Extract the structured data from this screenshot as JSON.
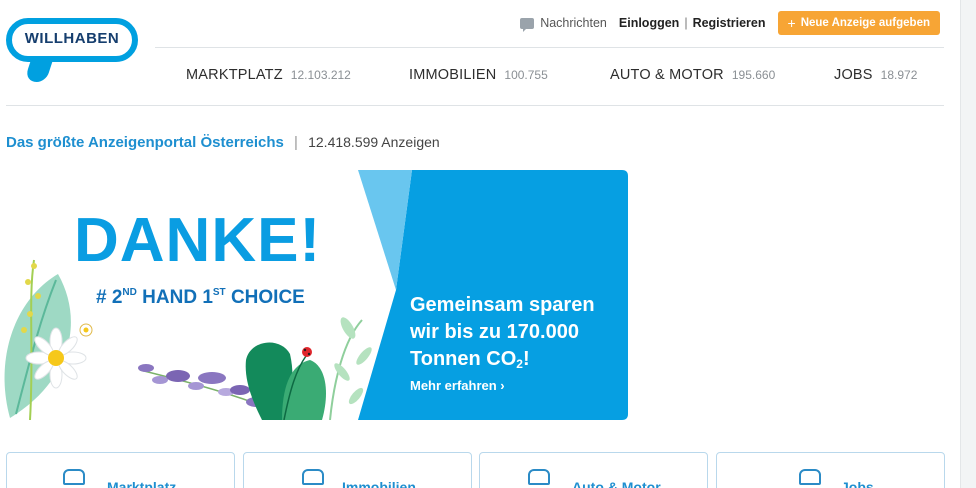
{
  "brand": {
    "logo_text": "WILLHABEN",
    "accent": "#00a0e0",
    "cta_color": "#f7a535"
  },
  "top_links": {
    "messages": "Nachrichten",
    "login": "Einloggen",
    "separator": "|",
    "register": "Registrieren",
    "cta_plus": "+",
    "cta": "Neue Anzeige aufgeben"
  },
  "nav": [
    {
      "label": "MARKTPLATZ",
      "count": "12.103.212"
    },
    {
      "label": "IMMOBILIEN",
      "count": "100.755"
    },
    {
      "label": "AUTO & MOTOR",
      "count": "195.660"
    },
    {
      "label": "JOBS",
      "count": "18.972"
    }
  ],
  "tagline": {
    "title": "Das größte Anzeigenportal Österreichs",
    "separator": "|",
    "count": "12.418.599 Anzeigen"
  },
  "banner": {
    "headline": "DANKE!",
    "claim_hash": "# 2",
    "claim_sup1": "ND",
    "claim_mid": " HAND 1",
    "claim_sup2": "ST",
    "claim_end": " CHOICE",
    "promo_line1": "Gemeinsam sparen",
    "promo_line2": "wir bis zu 170.000",
    "promo_line3_pre": "Tonnen CO",
    "promo_line3_sub": "2",
    "promo_line3_post": "!",
    "more": "Mehr erfahren ›"
  },
  "categories": [
    {
      "label": "Marktplatz",
      "icon": "basket-icon"
    },
    {
      "label": "Immobilien",
      "icon": "house-icon"
    },
    {
      "label": "Auto & Motor",
      "icon": "car-icon"
    },
    {
      "label": "Jobs",
      "icon": "people-icon"
    }
  ]
}
